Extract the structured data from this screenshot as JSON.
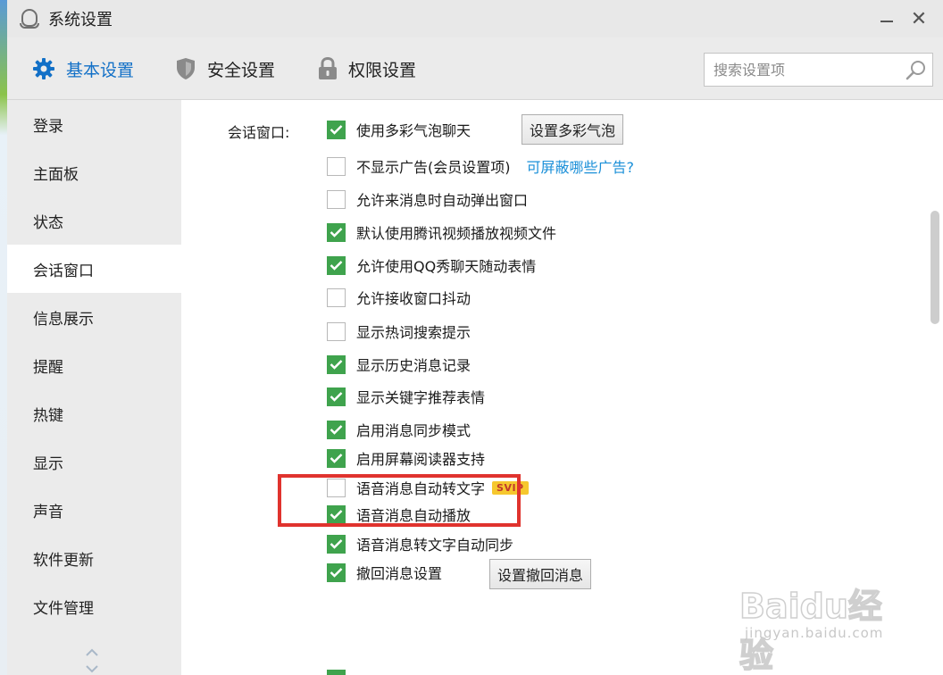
{
  "window": {
    "title": "系统设置",
    "close_glyph": "✕"
  },
  "toolbar": {
    "tabs": [
      {
        "label": "基本设置",
        "icon": "gear-icon",
        "active": true
      },
      {
        "label": "安全设置",
        "icon": "shield-icon",
        "active": false
      },
      {
        "label": "权限设置",
        "icon": "lock-icon",
        "active": false
      }
    ],
    "search_placeholder": "搜索设置项"
  },
  "sidebar": {
    "items": [
      {
        "label": "登录"
      },
      {
        "label": "主面板"
      },
      {
        "label": "状态"
      },
      {
        "label": "会话窗口",
        "active": true
      },
      {
        "label": "信息展示"
      },
      {
        "label": "提醒"
      },
      {
        "label": "热键"
      },
      {
        "label": "显示"
      },
      {
        "label": "声音"
      },
      {
        "label": "软件更新"
      },
      {
        "label": "文件管理"
      }
    ]
  },
  "content": {
    "section_label": "会话窗口:",
    "options": [
      {
        "label": "使用多彩气泡聊天",
        "checked": true
      },
      {
        "label": "不显示广告(会员设置项)",
        "checked": false
      },
      {
        "label": "允许来消息时自动弹出窗口",
        "checked": false
      },
      {
        "label": "默认使用腾讯视频播放视频文件",
        "checked": true
      },
      {
        "label": "允许使用QQ秀聊天随动表情",
        "checked": true
      },
      {
        "label": "允许接收窗口抖动",
        "checked": false
      },
      {
        "label": "显示热词搜索提示",
        "checked": false
      },
      {
        "label": "显示历史消息记录",
        "checked": true
      },
      {
        "label": "显示关键字推荐表情",
        "checked": true
      },
      {
        "label": "启用消息同步模式",
        "checked": true
      },
      {
        "label": "启用屏幕阅读器支持",
        "checked": true
      },
      {
        "label": "语音消息自动转文字",
        "checked": false
      },
      {
        "label": "语音消息自动播放",
        "checked": true
      },
      {
        "label": "语音消息转文字自动同步",
        "checked": true
      },
      {
        "label": "撤回消息设置",
        "checked": true
      }
    ],
    "bubble_button": "设置多彩气泡",
    "ad_link": "可屏蔽哪些广告?",
    "svip_badge": "SVIP",
    "recall_button": "设置撤回消息"
  },
  "watermark": {
    "text": "Baidu经验",
    "url": "jingyan.baidu.com"
  },
  "colors": {
    "accent": "#1270c7",
    "check_green": "#3fa34d",
    "highlight_red": "#e0332e",
    "link": "#1a8fd8"
  }
}
